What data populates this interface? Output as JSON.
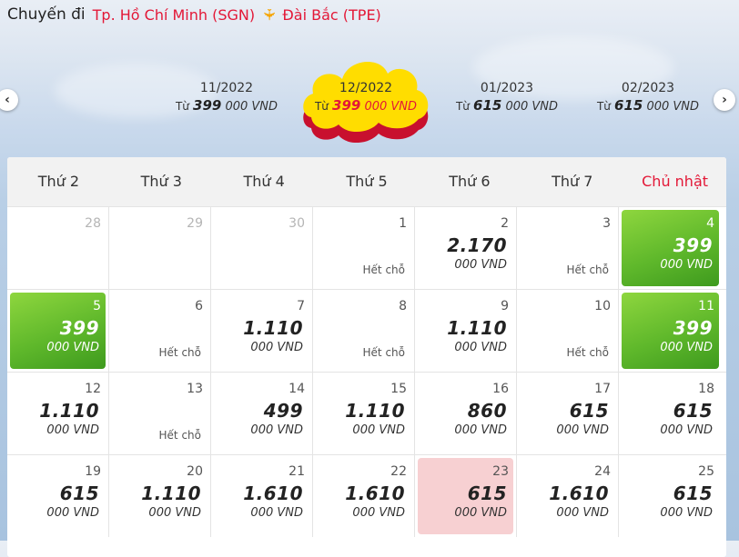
{
  "header": {
    "route_label": "Chuyến đi",
    "origin": "Tp. Hồ Chí Minh (SGN)",
    "destination": "Đài Bắc (TPE)",
    "icon": "plane-icon",
    "accent_color": "#e31837"
  },
  "months": [
    {
      "name": "11/2022",
      "from": "Từ",
      "price": "399",
      "unit": "000 VND",
      "active": false
    },
    {
      "name": "12/2022",
      "from": "Từ",
      "price": "399",
      "unit": "000 VND",
      "active": true
    },
    {
      "name": "01/2023",
      "from": "Từ",
      "price": "615",
      "unit": "000 VND",
      "active": false
    },
    {
      "name": "02/2023",
      "from": "Từ",
      "price": "615",
      "unit": "000 VND",
      "active": false
    }
  ],
  "nav": {
    "prev": "‹",
    "next": "›"
  },
  "weekdays": [
    "Thứ 2",
    "Thứ 3",
    "Thứ 4",
    "Thứ 5",
    "Thứ 6",
    "Thứ 7",
    "Chủ nhật"
  ],
  "calendar": {
    "rows": [
      [
        {
          "day": "28",
          "muted": true
        },
        {
          "day": "29",
          "muted": true
        },
        {
          "day": "30",
          "muted": true
        },
        {
          "day": "1",
          "soldout": "Hết chỗ"
        },
        {
          "day": "2",
          "price": "2.170",
          "unit": "000 VND"
        },
        {
          "day": "3",
          "soldout": "Hết chỗ"
        },
        {
          "day": "4",
          "price": "399",
          "unit": "000 VND",
          "style": "green"
        }
      ],
      [
        {
          "day": "5",
          "price": "399",
          "unit": "000 VND",
          "style": "green"
        },
        {
          "day": "6",
          "soldout": "Hết chỗ"
        },
        {
          "day": "7",
          "price": "1.110",
          "unit": "000 VND"
        },
        {
          "day": "8",
          "soldout": "Hết chỗ"
        },
        {
          "day": "9",
          "price": "1.110",
          "unit": "000 VND"
        },
        {
          "day": "10",
          "soldout": "Hết chỗ"
        },
        {
          "day": "11",
          "price": "399",
          "unit": "000 VND",
          "style": "green"
        }
      ],
      [
        {
          "day": "12",
          "price": "1.110",
          "unit": "000 VND"
        },
        {
          "day": "13",
          "soldout": "Hết chỗ"
        },
        {
          "day": "14",
          "price": "499",
          "unit": "000 VND"
        },
        {
          "day": "15",
          "price": "1.110",
          "unit": "000 VND"
        },
        {
          "day": "16",
          "price": "860",
          "unit": "000 VND"
        },
        {
          "day": "17",
          "price": "615",
          "unit": "000 VND"
        },
        {
          "day": "18",
          "price": "615",
          "unit": "000 VND"
        }
      ],
      [
        {
          "day": "19",
          "price": "615",
          "unit": "000 VND"
        },
        {
          "day": "20",
          "price": "1.110",
          "unit": "000 VND"
        },
        {
          "day": "21",
          "price": "1.610",
          "unit": "000 VND"
        },
        {
          "day": "22",
          "price": "1.610",
          "unit": "000 VND"
        },
        {
          "day": "23",
          "price": "615",
          "unit": "000 VND",
          "style": "pink"
        },
        {
          "day": "24",
          "price": "1.610",
          "unit": "000 VND"
        },
        {
          "day": "25",
          "price": "615",
          "unit": "000 VND"
        }
      ]
    ]
  }
}
